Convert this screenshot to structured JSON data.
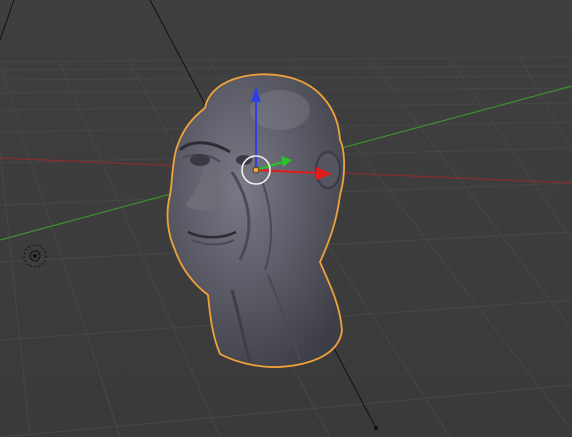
{
  "viewport": {
    "background_color": "#3d3d3d",
    "grid_color": "#454545",
    "axis_x_color": "#8a2b2b",
    "axis_y_color": "#3f8f2f",
    "selection_outline_color": "#f0a23a"
  },
  "object": {
    "type": "mesh-head",
    "selected": true,
    "color": "#5f5f6a"
  },
  "gizmo": {
    "x_color": "#e21b1b",
    "y_color": "#28c428",
    "z_color": "#2f3fe0"
  },
  "light": {
    "icon": "light-icon"
  },
  "camera_line": {
    "icon": "relationship-line"
  }
}
